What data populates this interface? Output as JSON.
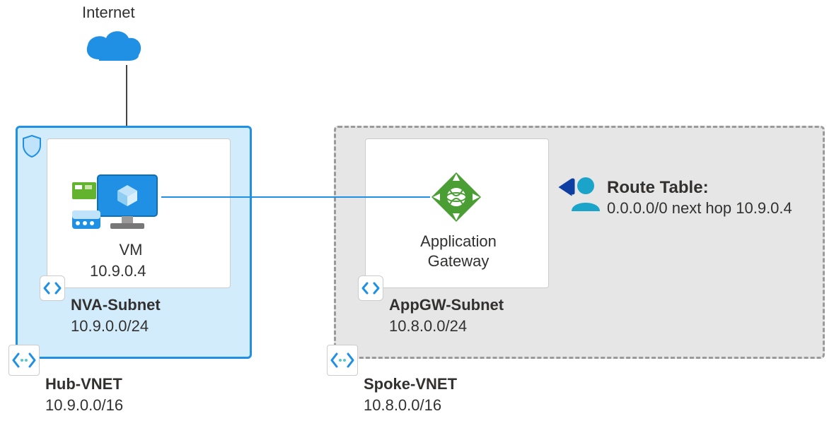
{
  "internet": {
    "label": "Internet"
  },
  "hub_vnet": {
    "name": "Hub-VNET",
    "cidr": "10.9.0.0/16",
    "subnet": {
      "name": "NVA-Subnet",
      "cidr": "10.9.0.0/24",
      "vm": {
        "label": "VM",
        "ip": "10.9.0.4"
      }
    }
  },
  "spoke_vnet": {
    "name": "Spoke-VNET",
    "cidr": "10.8.0.0/16",
    "subnet": {
      "name": "AppGW-Subnet",
      "cidr": "10.8.0.0/24",
      "appgw": {
        "label_line1": "Application",
        "label_line2": "Gateway"
      }
    }
  },
  "route_table": {
    "title": "Route Table:",
    "rule": "0.0.0.0/0 next hop 10.9.0.4"
  }
}
